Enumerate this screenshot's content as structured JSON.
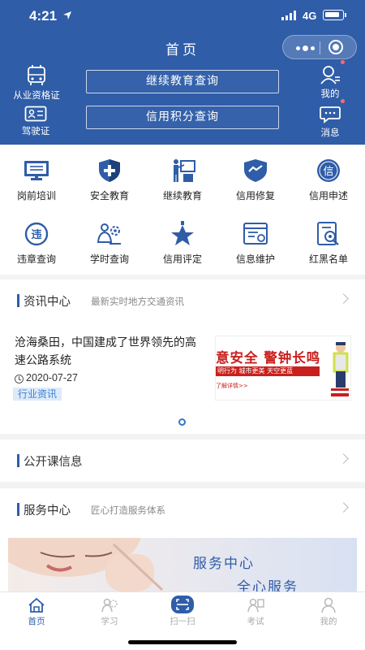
{
  "status_bar": {
    "time": "4:21",
    "network": "4G"
  },
  "header": {
    "title": "首页",
    "left_items": [
      {
        "label": "从业资格证",
        "icon": "bus-certificate-icon"
      },
      {
        "label": "驾驶证",
        "icon": "driver-license-icon"
      }
    ],
    "right_items": [
      {
        "label": "我的",
        "icon": "user-icon"
      },
      {
        "label": "消息",
        "icon": "message-icon"
      }
    ],
    "buttons": [
      "继续教育查询",
      "信用积分查询"
    ]
  },
  "grid": [
    {
      "label": "岗前培训",
      "icon": "monitor-icon"
    },
    {
      "label": "安全教育",
      "icon": "shield-icon"
    },
    {
      "label": "继续教育",
      "icon": "classroom-icon"
    },
    {
      "label": "信用修复",
      "icon": "shield-chart-icon"
    },
    {
      "label": "信用申述",
      "icon": "credit-badge-icon"
    },
    {
      "label": "违章查询",
      "icon": "violation-icon"
    },
    {
      "label": "学时查询",
      "icon": "study-hours-icon"
    },
    {
      "label": "信用评定",
      "icon": "star-award-icon"
    },
    {
      "label": "信息维护",
      "icon": "info-settings-icon"
    },
    {
      "label": "红黑名单",
      "icon": "list-search-icon"
    }
  ],
  "news_section": {
    "title": "资讯中心",
    "subtitle": "最新实时地方交通资讯"
  },
  "news_item": {
    "title": "沧海桑田，中国建成了世界领先的高速公路系统",
    "date": "2020-07-27",
    "tag": "行业资讯",
    "image_headline": "意安全  警钟长鸣",
    "image_sub": "明行为 城市更美 天空更蓝",
    "image_more": "了解详情>>"
  },
  "course_section": {
    "title": "公开课信息"
  },
  "service_section": {
    "title": "服务中心",
    "subtitle": "匠心打造服务体系"
  },
  "promo": {
    "line1": "服务中心",
    "line2": "全心服务"
  },
  "tabs": [
    {
      "label": "首页",
      "icon": "home-icon",
      "active": true
    },
    {
      "label": "学习",
      "icon": "study-icon",
      "active": false
    },
    {
      "label": "扫一扫",
      "icon": "scan-icon",
      "active": false
    },
    {
      "label": "考试",
      "icon": "exam-icon",
      "active": false
    },
    {
      "label": "我的",
      "icon": "profile-icon",
      "active": false
    }
  ],
  "colors": {
    "primary": "#2f5da8",
    "accent_red": "#c8201e",
    "tag_blue": "#3c7fd0"
  }
}
